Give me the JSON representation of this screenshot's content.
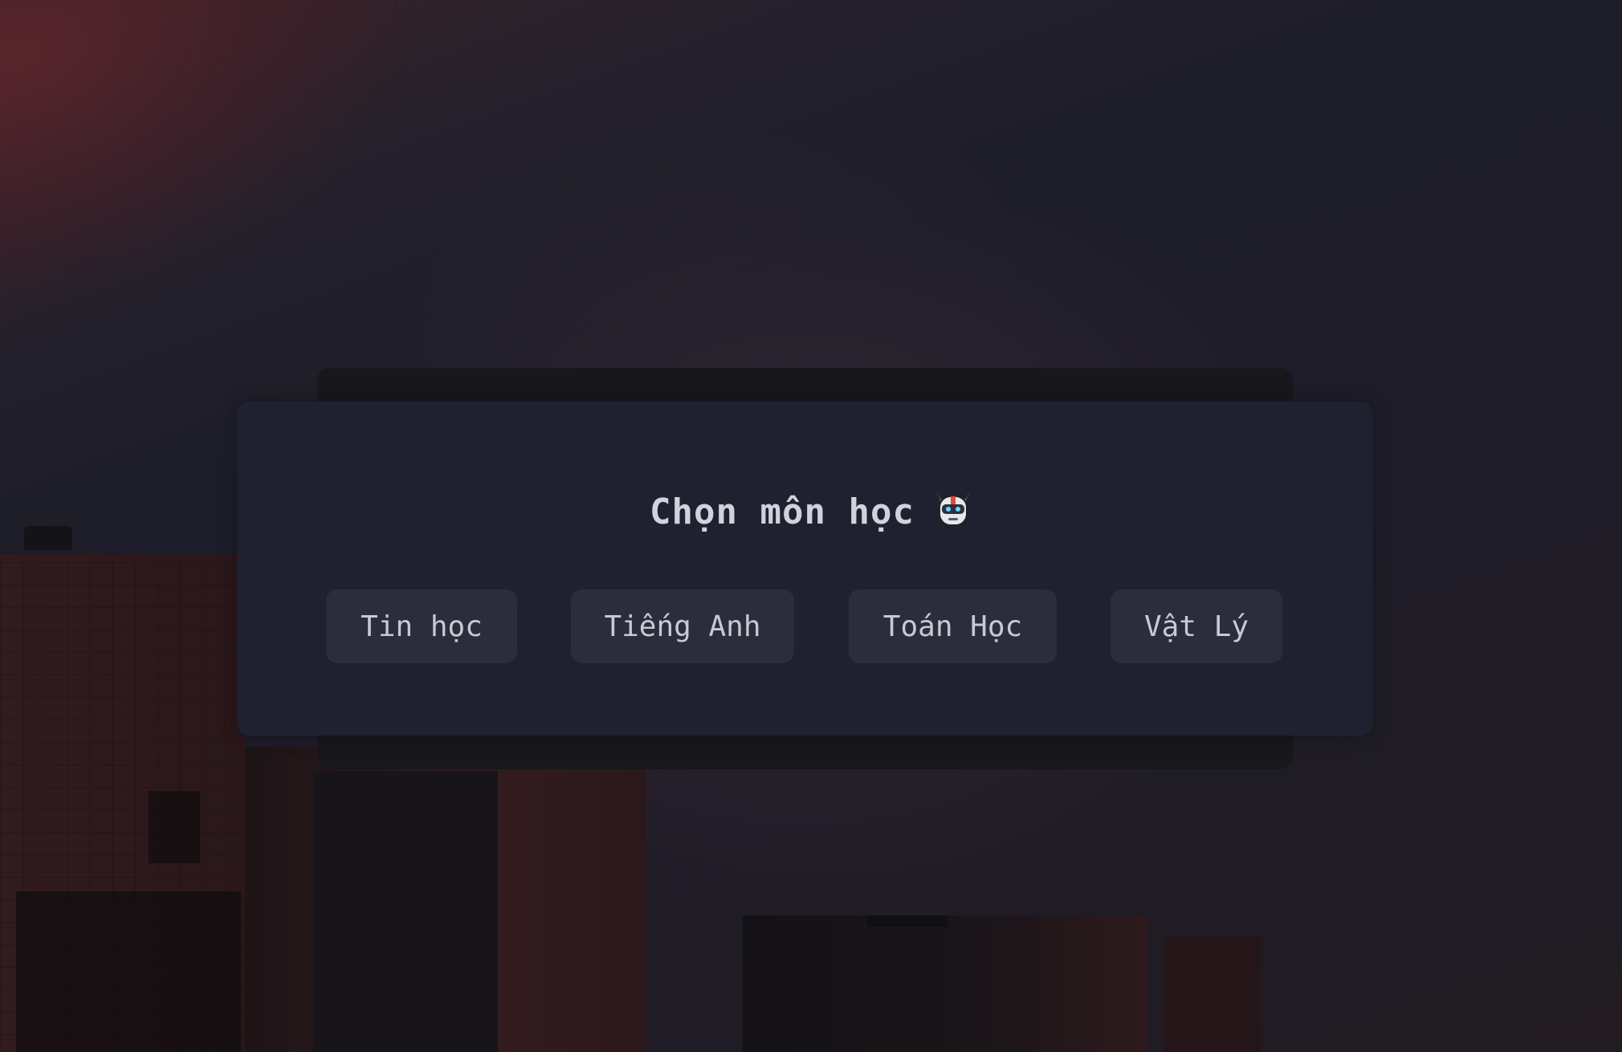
{
  "title": "Chọn môn học",
  "title_icon": "robot-icon",
  "subjects": [
    {
      "label": "Tin học"
    },
    {
      "label": "Tiếng Anh"
    },
    {
      "label": "Toán Học"
    },
    {
      "label": "Vật Lý"
    }
  ],
  "colors": {
    "card": "#1f2030",
    "button": "#2c2c3c",
    "text": "#d2d2dc"
  }
}
